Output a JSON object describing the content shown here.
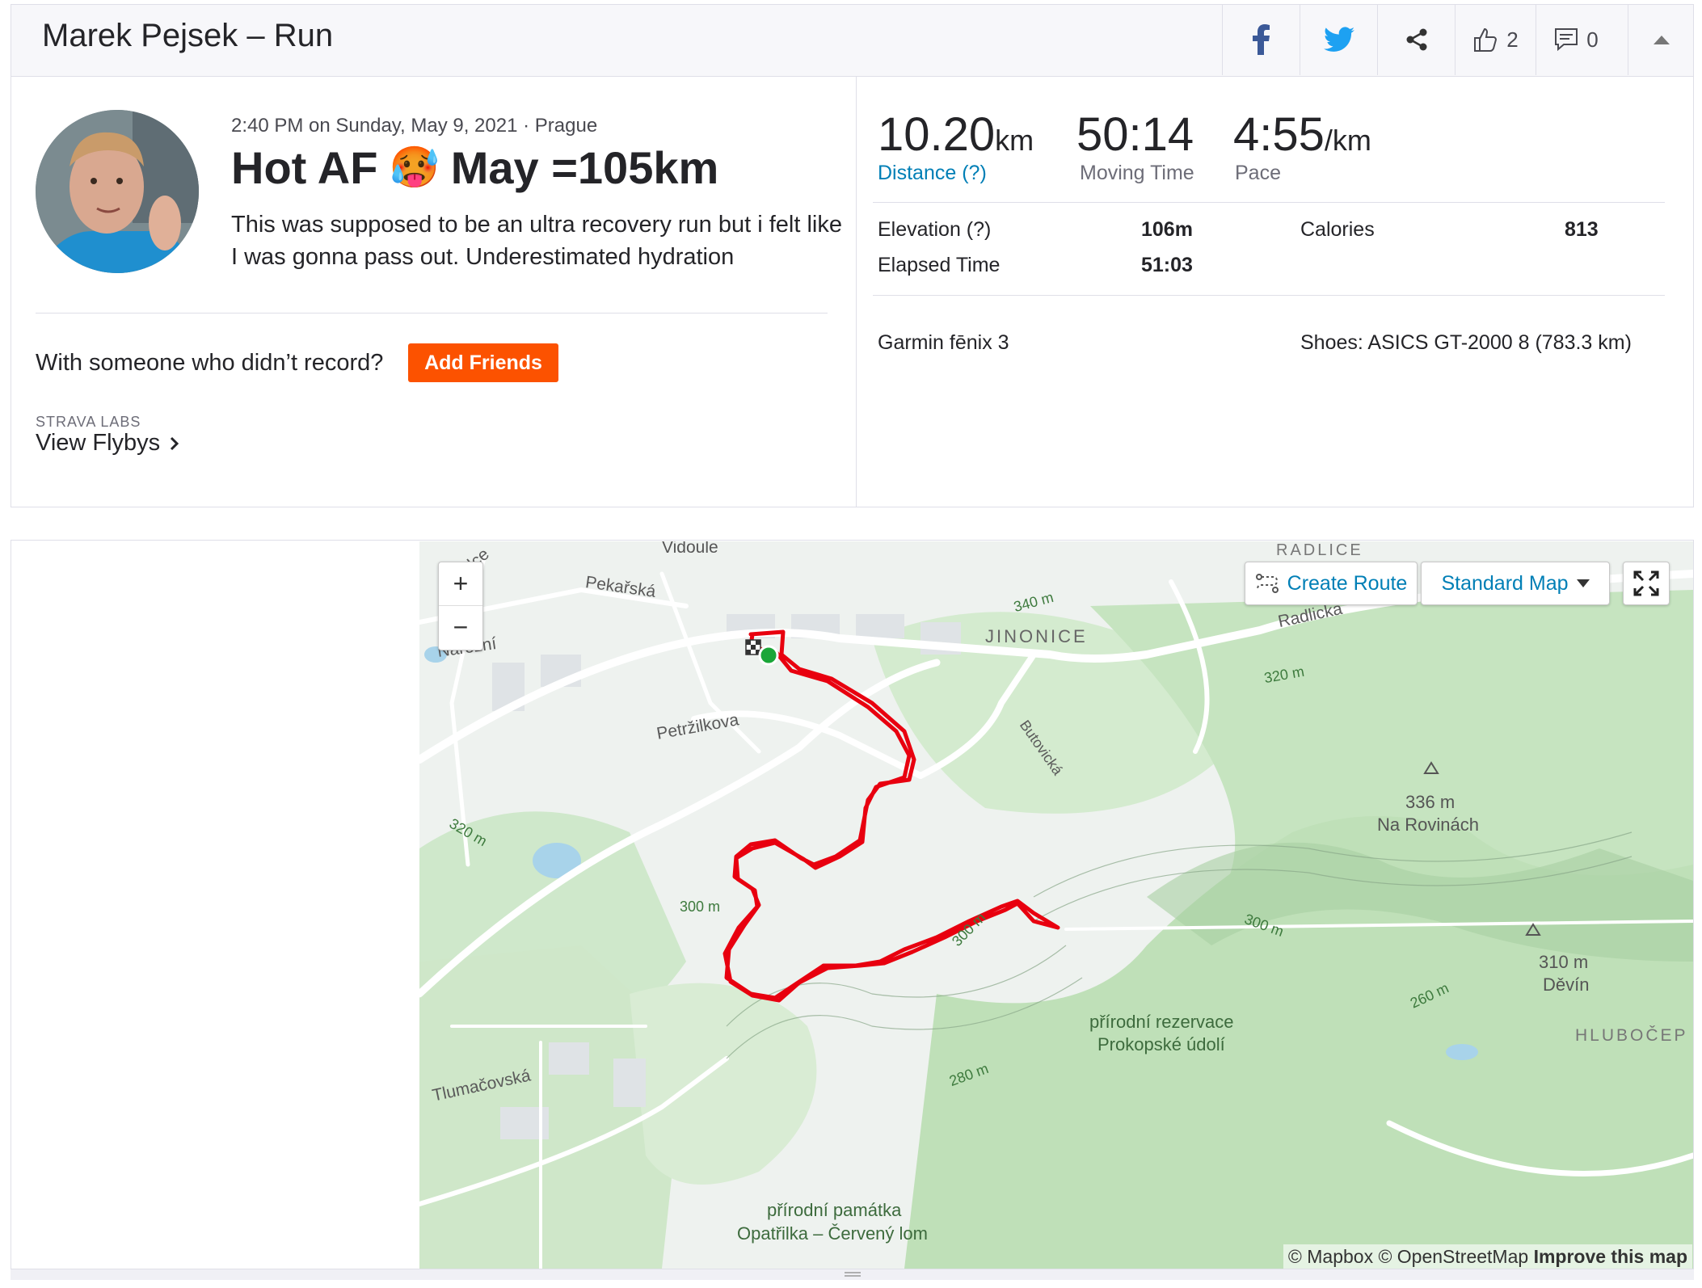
{
  "header": {
    "title": "Marek Pejsek – Run",
    "kudos_count": "2",
    "comments_count": "0"
  },
  "activity": {
    "meta": "2:40 PM on Sunday, May 9, 2021 · Prague",
    "title_part1": "Hot AF",
    "title_emoji": "🥵",
    "title_part2": "May =105km",
    "description": "This was supposed to be an ultra recovery run but i felt like I was gonna pass out. Underestimated hydration",
    "with_text": "With someone who didn’t record?",
    "add_friends": "Add Friends",
    "labs_caption": "STRAVA LABS",
    "flybys": "View Flybys"
  },
  "stats": {
    "distance_value": "10.20",
    "distance_unit": "km",
    "distance_label": "Distance (?)",
    "moving_value": "50:14",
    "moving_label": "Moving Time",
    "pace_value": "4:55",
    "pace_unit": "/km",
    "pace_label": "Pace",
    "elevation_label": "Elevation (?)",
    "elevation_value": "106m",
    "calories_label": "Calories",
    "calories_value": "813",
    "elapsed_label": "Elapsed Time",
    "elapsed_value": "51:03",
    "device": "Garmin fēnix 3",
    "shoes": "Shoes: ASICS GT-2000 8 (783.3 km)"
  },
  "map": {
    "create_route": "Create Route",
    "map_type": "Standard Map",
    "zoom_in": "+",
    "zoom_out": "−",
    "attribution_1": "© Mapbox © OpenStreetMap",
    "attribution_2": "Improve this map",
    "labels": {
      "vidoule": "Vidoule",
      "pekarska": "Pekařská",
      "narozni": "Nárožní",
      "petrzilkova": "Petržilkova",
      "jinonice": "JINONICE",
      "radlicka": "Radlická",
      "radlice": "RADLICE",
      "e340": "340 m",
      "e320a": "320 m",
      "e320b": "320 m",
      "e300a": "300 m",
      "e300b": "300 m",
      "e300c": "300 m",
      "e280": "280 m",
      "e260": "260 m",
      "rovinach_elev": "336 m",
      "rovinach": "Na Rovinách",
      "devin_elev": "310 m",
      "devin": "Děvín",
      "hlubocepy": "HLUBOČEP",
      "reserve1": "přírodní rezervace",
      "reserve2": "Prokopské údolí",
      "tlumacovska": "Tlumačovská",
      "monument1": "přírodní památka",
      "monument2": "Opatřilka – Červený lom",
      "butovicka": "Butovická",
      "lce": "lce"
    },
    "colors": {
      "route": "#e8000f",
      "park": "#c9e6c4",
      "water": "#a8d3ea",
      "road": "#ffffff"
    }
  }
}
